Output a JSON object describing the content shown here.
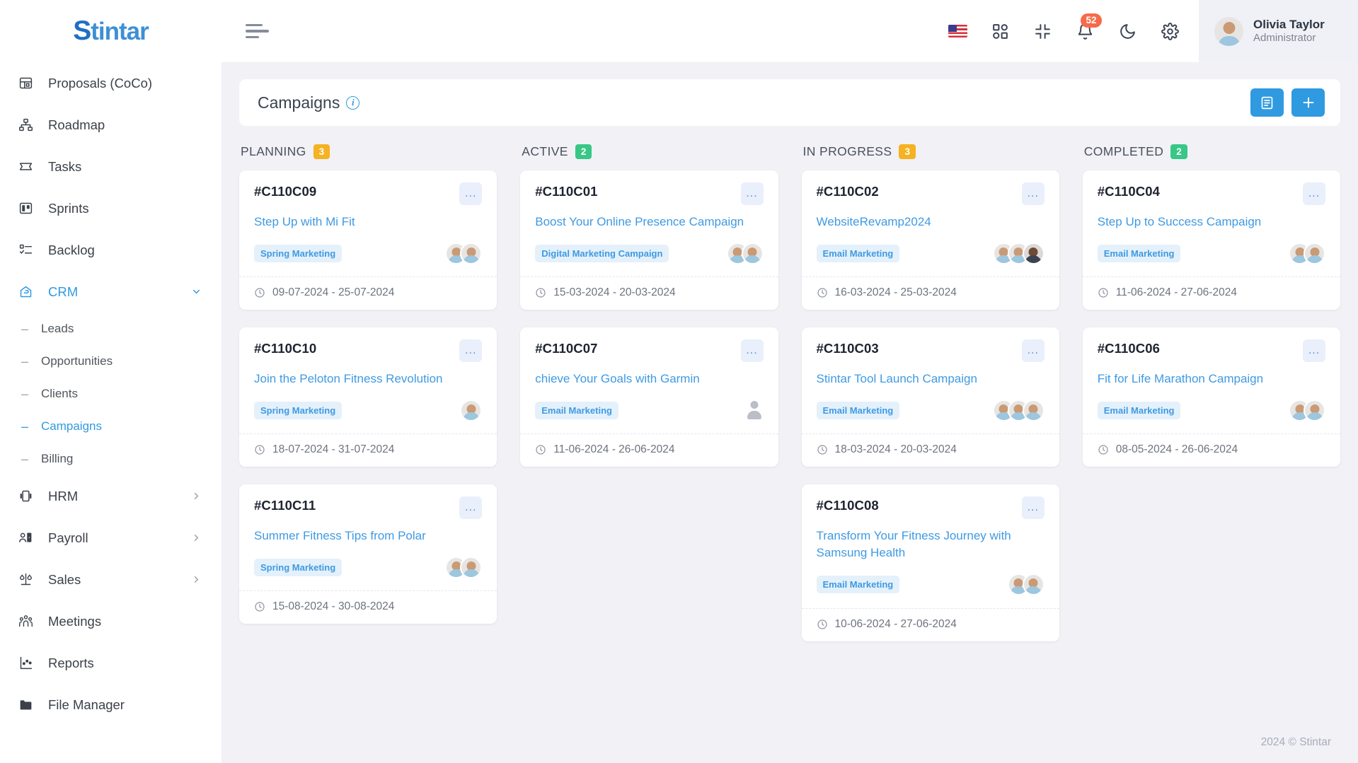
{
  "brand": {
    "logo_text": "Stintar",
    "accent_color": "#2f9ae0"
  },
  "sidebar": {
    "items": [
      {
        "label": "Proposals (CoCo)",
        "icon": "proposals-icon",
        "active": false,
        "chevron": ""
      },
      {
        "label": "Roadmap",
        "icon": "roadmap-icon",
        "active": false,
        "chevron": ""
      },
      {
        "label": "Tasks",
        "icon": "tasks-icon",
        "active": false,
        "chevron": ""
      },
      {
        "label": "Sprints",
        "icon": "sprints-icon",
        "active": false,
        "chevron": ""
      },
      {
        "label": "Backlog",
        "icon": "backlog-icon",
        "active": false,
        "chevron": ""
      },
      {
        "label": "CRM",
        "icon": "crm-icon",
        "active": true,
        "chevron": "expanded"
      },
      {
        "label": "HRM",
        "icon": "hrm-icon",
        "active": false,
        "chevron": "collapsed"
      },
      {
        "label": "Payroll",
        "icon": "payroll-icon",
        "active": false,
        "chevron": "collapsed"
      },
      {
        "label": "Sales",
        "icon": "sales-icon",
        "active": false,
        "chevron": "collapsed"
      },
      {
        "label": "Meetings",
        "icon": "meetings-icon",
        "active": false,
        "chevron": ""
      },
      {
        "label": "Reports",
        "icon": "reports-icon",
        "active": false,
        "chevron": ""
      },
      {
        "label": "File Manager",
        "icon": "folder-icon",
        "active": false,
        "chevron": ""
      }
    ],
    "crm_subitems": [
      {
        "label": "Leads",
        "active": false
      },
      {
        "label": "Opportunities",
        "active": false
      },
      {
        "label": "Clients",
        "active": false
      },
      {
        "label": "Campaigns",
        "active": true
      },
      {
        "label": "Billing",
        "active": false
      }
    ]
  },
  "topbar": {
    "menu_toggle": "menu-toggle",
    "icons": [
      {
        "name": "language-flag-icon",
        "label": "US"
      },
      {
        "name": "apps-grid-icon",
        "label": "Apps"
      },
      {
        "name": "fullscreen-exit-icon",
        "label": "Fullscreen"
      },
      {
        "name": "notifications-bell-icon",
        "label": "Notifications",
        "badge": "52"
      },
      {
        "name": "dark-mode-icon",
        "label": "Dark mode"
      },
      {
        "name": "settings-gear-icon",
        "label": "Settings"
      }
    ],
    "notification_count": "52",
    "profile": {
      "name": "Olivia Taylor",
      "role": "Administrator"
    }
  },
  "page": {
    "title": "Campaigns",
    "info_glyph": "i",
    "list_view_label": "List view",
    "add_label": "+"
  },
  "board": {
    "columns": [
      {
        "title": "PLANNING",
        "count": "3",
        "count_color": "#f5b221",
        "cards": [
          {
            "id": "#C110C09",
            "title": "Step Up with Mi Fit",
            "tag": "Spring Marketing",
            "date": "09-07-2024 - 25-07-2024",
            "avatars": [
              "light",
              "light"
            ],
            "menu": "..."
          },
          {
            "id": "#C110C10",
            "title": "Join the Peloton Fitness Revolution",
            "tag": "Spring Marketing",
            "date": "18-07-2024 - 31-07-2024",
            "avatars": [
              "light"
            ],
            "menu": "..."
          },
          {
            "id": "#C110C11",
            "title": "Summer Fitness Tips from Polar",
            "tag": "Spring Marketing",
            "date": "15-08-2024 - 30-08-2024",
            "avatars": [
              "light",
              "light"
            ],
            "menu": "..."
          }
        ]
      },
      {
        "title": "ACTIVE",
        "count": "2",
        "count_color": "#38c786",
        "cards": [
          {
            "id": "#C110C01",
            "title": "Boost Your Online Presence Campaign",
            "tag": "Digital Marketing Campaign",
            "date": "15-03-2024 - 20-03-2024",
            "avatars": [
              "light",
              "light"
            ],
            "menu": "..."
          },
          {
            "id": "#C110C07",
            "title": "chieve Your Goals with Garmin",
            "tag": "Email Marketing",
            "date": "11-06-2024 - 26-06-2024",
            "avatars": [
              "placeholder"
            ],
            "menu": "..."
          }
        ]
      },
      {
        "title": "IN PROGRESS",
        "count": "3",
        "count_color": "#f5b221",
        "cards": [
          {
            "id": "#C110C02",
            "title": "WebsiteRevamp2024",
            "tag": "Email Marketing",
            "date": "16-03-2024 - 25-03-2024",
            "avatars": [
              "light",
              "light",
              "dark"
            ],
            "menu": "..."
          },
          {
            "id": "#C110C03",
            "title": "Stintar Tool Launch Campaign",
            "tag": "Email Marketing",
            "date": "18-03-2024 - 20-03-2024",
            "avatars": [
              "light",
              "light",
              "light"
            ],
            "menu": "..."
          },
          {
            "id": "#C110C08",
            "title": "Transform Your Fitness Journey with Samsung Health",
            "tag": "Email Marketing",
            "date": "10-06-2024 - 27-06-2024",
            "avatars": [
              "light",
              "light"
            ],
            "menu": "..."
          }
        ]
      },
      {
        "title": "COMPLETED",
        "count": "2",
        "count_color": "#38c786",
        "cards": [
          {
            "id": "#C110C04",
            "title": "Step Up to Success Campaign",
            "tag": "Email Marketing",
            "date": "11-06-2024 - 27-06-2024",
            "avatars": [
              "light",
              "light"
            ],
            "menu": "..."
          },
          {
            "id": "#C110C06",
            "title": "Fit for Life Marathon Campaign",
            "tag": "Email Marketing",
            "date": "08-05-2024 - 26-06-2024",
            "avatars": [
              "light",
              "light"
            ],
            "menu": "..."
          }
        ]
      }
    ]
  },
  "footer": {
    "text": "2024 © Stintar"
  }
}
